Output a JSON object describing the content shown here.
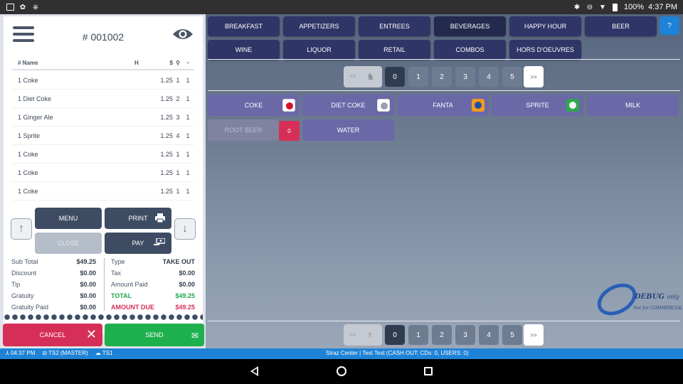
{
  "status_bar": {
    "time": "4:37 PM",
    "battery": "100%"
  },
  "order": {
    "number": "# 001002",
    "columns": {
      "name": "# Name",
      "hold": "H",
      "price": "$"
    },
    "items": [
      {
        "name": "1 Coke",
        "price": "1.25",
        "seat": "1",
        "course": "1"
      },
      {
        "name": "1 Diet Coke",
        "price": "1.25",
        "seat": "2",
        "course": "1"
      },
      {
        "name": "1 Ginger Ale",
        "price": "1.25",
        "seat": "3",
        "course": "1"
      },
      {
        "name": "1 Sprite",
        "price": "1.25",
        "seat": "4",
        "course": "1"
      },
      {
        "name": "1 Coke",
        "price": "1.25",
        "seat": "1",
        "course": "1"
      },
      {
        "name": "1 Coke",
        "price": "1.25",
        "seat": "1",
        "course": "1"
      },
      {
        "name": "1 Coke",
        "price": "1.25",
        "seat": "1",
        "course": "1"
      }
    ]
  },
  "actions": {
    "menu": "MENU",
    "print": "PRINT",
    "close": "CLOSE",
    "pay": "PAY",
    "cancel": "CANCEL",
    "send": "SEND"
  },
  "totals": {
    "left": [
      {
        "label": "Sub Total",
        "value": "$49.25"
      },
      {
        "label": "Discount",
        "value": "$0.00"
      },
      {
        "label": "Tip",
        "value": "$0.00"
      },
      {
        "label": "Gratuity",
        "value": "$0.00"
      },
      {
        "label": "Gratuity Paid",
        "value": "$0.00"
      }
    ],
    "right": [
      {
        "label": "Type",
        "value": "TAKE OUT"
      },
      {
        "label": "Tax",
        "value": "$0.00"
      },
      {
        "label": "Amount Paid",
        "value": "$0.00"
      },
      {
        "label": "TOTAL",
        "value": "$49.25"
      },
      {
        "label": "AMOUNT DUE",
        "value": "$49.25"
      }
    ]
  },
  "categories": [
    "BREAKFAST",
    "APPETIZERS",
    "ENTREES",
    "BEVERAGES",
    "HAPPY HOUR",
    "BEER",
    "WINE",
    "LIQUOR",
    "RETAIL",
    "COMBOS",
    "HORS D'OEUVRES"
  ],
  "active_category": "BEVERAGES",
  "help_label": "?",
  "pager": {
    "prev": "<<",
    "next": ">>",
    "pages": [
      "0",
      "1",
      "2",
      "3",
      "4",
      "5"
    ],
    "active": "0"
  },
  "menu_items": [
    {
      "label": "COKE",
      "logo": "coke-logo-icon"
    },
    {
      "label": "DIET COKE",
      "logo": "diet-coke-logo-icon"
    },
    {
      "label": "FANTA",
      "logo": "fanta-logo-icon"
    },
    {
      "label": "SPRITE",
      "logo": "sprite-logo-icon"
    },
    {
      "label": "MILK"
    },
    {
      "label": "ROOT BEER",
      "badge": "0"
    },
    {
      "label": "WATER"
    }
  ],
  "watermark": {
    "title": "DEBUG",
    "suffix": "only",
    "subtitle": "Not for COMMERCIAL"
  },
  "info_bar": {
    "time": "04:37 PM",
    "station": "TS2 (MASTER)",
    "terminal": "TS1",
    "center": "Straz Center | Test Test (CASH OUT: CDs: 0, USERS: 0)"
  },
  "colors": {
    "accent": "#1e82d6",
    "cancel": "#d62f57",
    "send": "#1fb04e",
    "category": "#2f3567",
    "item": "#6b68a8"
  }
}
